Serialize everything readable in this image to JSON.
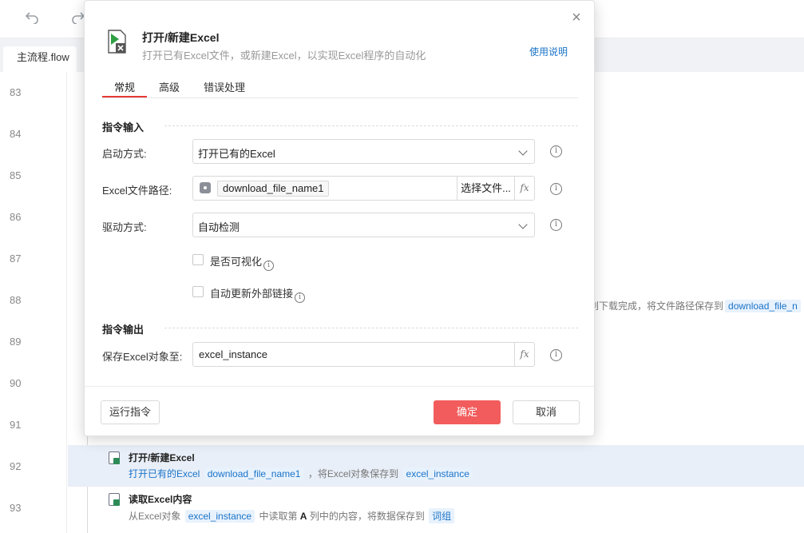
{
  "toolbar": {
    "undo_icon": "undo-icon",
    "redo_icon": "redo-icon"
  },
  "tab": {
    "file_name": "主流程.flow"
  },
  "editor": {
    "line_numbers": [
      "83",
      "84",
      "85",
      "86",
      "87",
      "88",
      "89",
      "90",
      "91",
      "92",
      "93"
    ],
    "bg_fragment": {
      "text": "到下载完成，将文件路径保存到",
      "var": "download_file_n"
    },
    "steps": [
      {
        "title": "打开/新建Excel",
        "desc_parts": [
          "打开已有的Excel",
          "download_file_name1",
          "，将Excel对象保存到",
          "excel_instance"
        ]
      },
      {
        "title": "读取Excel内容",
        "desc_parts": [
          "从Excel对象",
          "excel_instance",
          "中读取第",
          "A",
          "列中的内容，将数据保存到",
          "词组"
        ]
      }
    ]
  },
  "dialog": {
    "title": "打开/新建Excel",
    "subtitle": "打开已有Excel文件，或新建Excel，以实现Excel程序的自动化",
    "help_link": "使用说明",
    "close_icon": "×",
    "tabs": [
      {
        "label": "常规",
        "active": true
      },
      {
        "label": "高级",
        "active": false
      },
      {
        "label": "错误处理",
        "active": false
      }
    ],
    "input_section_title": "指令输入",
    "output_section_title": "指令输出",
    "fields": {
      "launch_mode": {
        "label": "启动方式:",
        "value": "打开已有的Excel"
      },
      "file_path": {
        "label": "Excel文件路径:",
        "value": "download_file_name1",
        "choose_label": "选择文件...",
        "fx_label": "fx"
      },
      "driver_mode": {
        "label": "驱动方式:",
        "value": "自动检测"
      },
      "visible": {
        "label": "是否可视化",
        "checked": false
      },
      "auto_update_links": {
        "label": "自动更新外部链接",
        "checked": false
      },
      "save_to": {
        "label": "保存Excel对象至:",
        "value": "excel_instance",
        "fx_label": "fx"
      }
    },
    "info_glyph": "i",
    "buttons": {
      "run": "运行指令",
      "ok": "确定",
      "cancel": "取消"
    },
    "colors": {
      "accent": "#f25c5c",
      "link": "#1a73c8",
      "tab_underline": "#e53935"
    }
  }
}
